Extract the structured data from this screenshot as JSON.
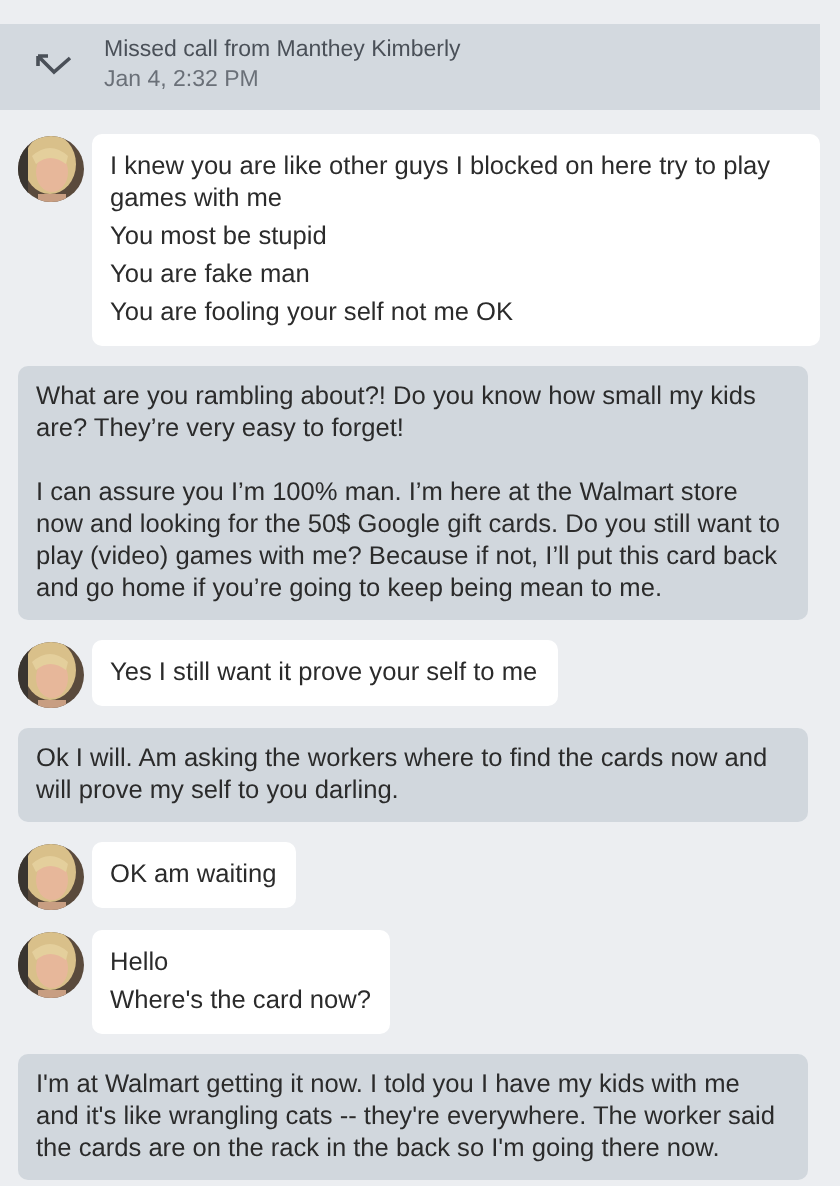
{
  "missed_call": {
    "title": "Missed call from Manthey Kimberly",
    "time": "Jan 4, 2:32 PM"
  },
  "messages": [
    {
      "kind": "incoming",
      "avatar": {
        "kind": "picture"
      },
      "lines": [
        "I knew you are like other guys I blocked on here try to play games with me",
        "You most be stupid",
        "You are fake man",
        "You are fooling your self not me OK"
      ]
    },
    {
      "kind": "outgoing",
      "paragraphs": [
        "What are you rambling about?! Do you know how small my kids are? They’re very easy to forget!",
        "I can assure you I’m 100% man. I’m here at the Walmart store now and looking for the 50$ Google gift cards. Do you still want to play (video) games with me? Because if not, I’ll put this card back and go home if you’re going to keep being mean to me."
      ]
    },
    {
      "kind": "incoming",
      "avatar": {
        "kind": "picture"
      },
      "lines": [
        "Yes I still want it prove your self to me"
      ]
    },
    {
      "kind": "outgoing",
      "paragraphs": [
        "Ok I will. Am asking the workers where to find the cards now and will prove my self to you darling."
      ]
    },
    {
      "kind": "incoming",
      "avatar": {
        "kind": "picture"
      },
      "lines": [
        "OK am waiting"
      ]
    },
    {
      "kind": "incoming",
      "avatar": {
        "kind": "picture"
      },
      "lines": [
        "Hello",
        "Where's the card now?"
      ]
    },
    {
      "kind": "outgoing",
      "paragraphs": [
        "I'm at Walmart getting it now. I told you I have my kids with me and it's like wrangling cats -- they're everywhere. The worker said the cards are on the rack in the back so I'm going there now."
      ]
    }
  ]
}
